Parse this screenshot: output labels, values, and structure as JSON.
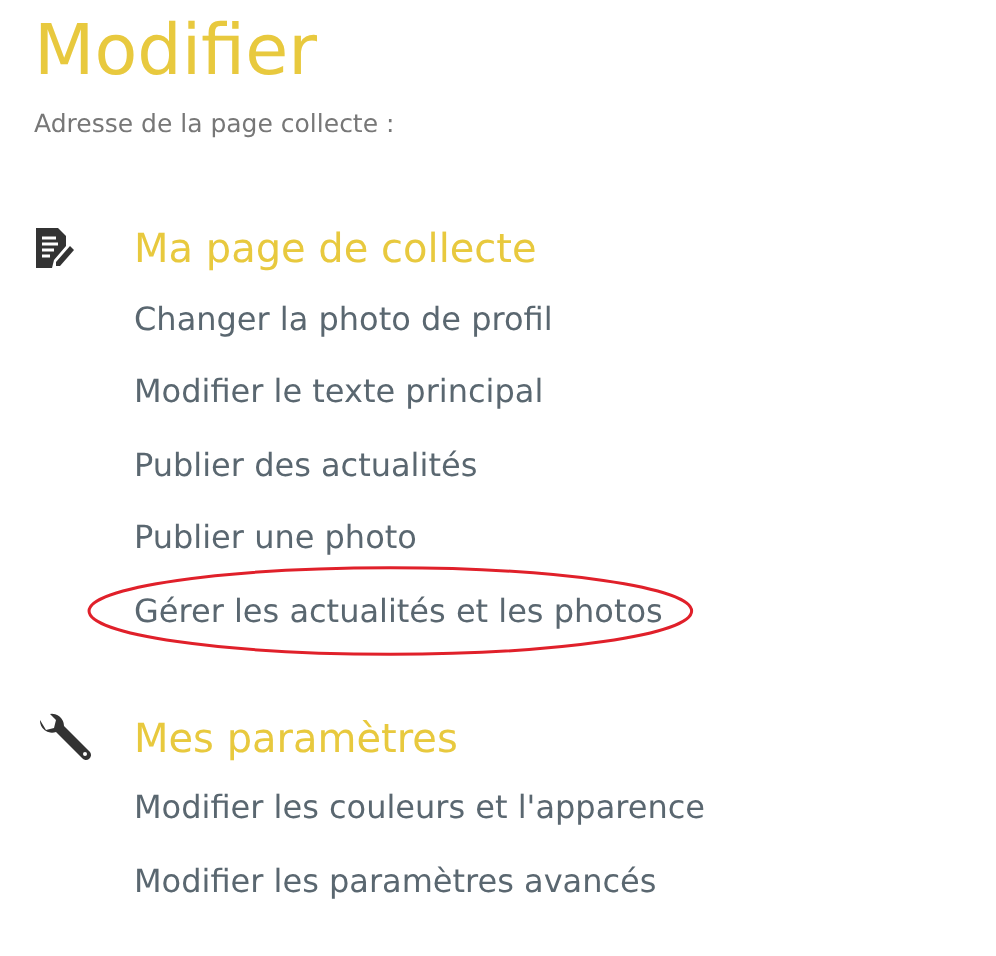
{
  "title": "Modifier",
  "subtitle": "Adresse de la page collecte :",
  "sections": [
    {
      "kind": "edit",
      "heading": "Ma page de collecte",
      "links": [
        {
          "label": "Changer la photo de profil",
          "circled": false
        },
        {
          "label": "Modifier le texte principal",
          "circled": false
        },
        {
          "label": "Publier des actualités",
          "circled": false
        },
        {
          "label": "Publier une photo",
          "circled": false
        },
        {
          "label": "Gérer les actualités et les photos",
          "circled": true
        }
      ]
    },
    {
      "kind": "settings",
      "heading": "Mes paramètres",
      "links": [
        {
          "label": "Modifier les couleurs et l'apparence",
          "circled": false
        },
        {
          "label": "Modifier les paramètres avancés",
          "circled": false
        }
      ]
    }
  ]
}
